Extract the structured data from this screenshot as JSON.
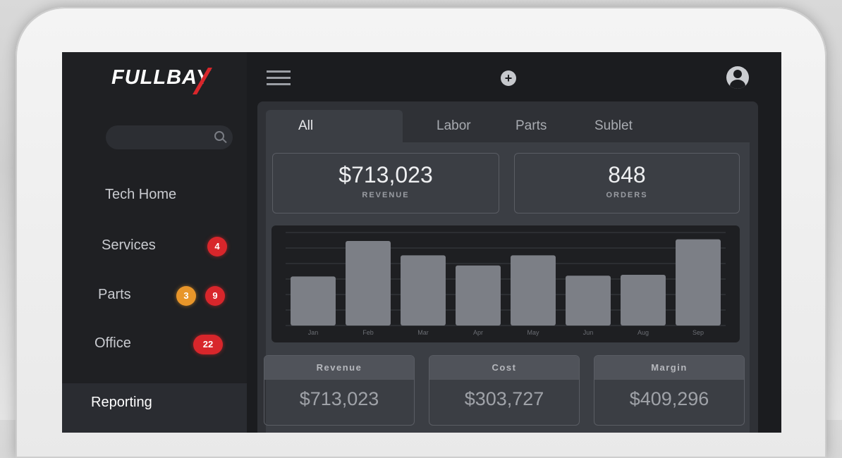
{
  "app": {
    "logo": "FULLBAY"
  },
  "sidebar": {
    "search_placeholder": "",
    "items": [
      {
        "label": "Tech Home"
      },
      {
        "label": "Services",
        "badges": [
          "4"
        ]
      },
      {
        "label": "Parts",
        "badges": [
          "3",
          "9"
        ]
      },
      {
        "label": "Office",
        "badges": [
          "22"
        ]
      },
      {
        "label": "Reporting",
        "active": true
      }
    ]
  },
  "tabs": [
    "All Revenue",
    "Labor",
    "Parts",
    "Sublet"
  ],
  "kpis": {
    "revenue": {
      "value": "$713,023",
      "label": "REVENUE"
    },
    "orders": {
      "value": "848",
      "label": "ORDERS"
    }
  },
  "chart_data": {
    "type": "bar",
    "categories": [
      "Jan",
      "Feb",
      "Mar",
      "Apr",
      "May",
      "Jun",
      "Aug",
      "Sep"
    ],
    "values": [
      58,
      100,
      83,
      71,
      83,
      59,
      60,
      102
    ],
    "ylim": [
      0,
      110
    ],
    "grid": true
  },
  "cards": [
    {
      "title": "Revenue",
      "value": "$713,023"
    },
    {
      "title": "Cost",
      "value": "$303,727"
    },
    {
      "title": "Margin",
      "value": "$409,296"
    }
  ],
  "colors": {
    "accent_red": "#d8262b",
    "badge_orange": "#e8962a",
    "bar": "#7c7f86"
  }
}
